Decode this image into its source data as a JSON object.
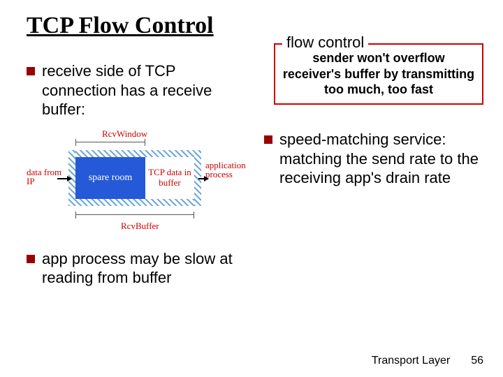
{
  "title": "TCP Flow Control",
  "flowcontrol": {
    "label": "flow control",
    "box": "sender won't overflow receiver's buffer by transmitting too much, too fast"
  },
  "left": {
    "b1": "receive side of TCP connection has a receive buffer:",
    "b2": "app process may be slow at reading from buffer"
  },
  "right": {
    "b1": "speed-matching service: matching the send rate to the receiving app's drain rate"
  },
  "diagram": {
    "rcv_window": "RcvWindow",
    "rcv_buffer": "RcvBuffer",
    "spare": "spare room",
    "tcp_data": "TCP data in buffer",
    "data_from_ip": "data from IP",
    "application_process": "application process"
  },
  "footer": {
    "layer": "Transport Layer",
    "page": "56"
  }
}
